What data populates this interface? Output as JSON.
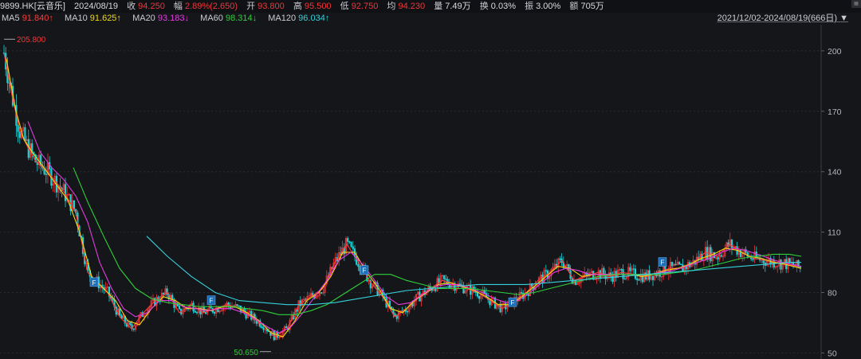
{
  "header": {
    "symbol": "9899.HK[云音乐]",
    "date": "2024/08/19",
    "close_label": "收",
    "close": "94.250",
    "change_label": "幅",
    "change": "2.89%(2.650)",
    "open_label": "开",
    "open": "93.800",
    "high_label": "高",
    "high": "95.500",
    "low_label": "低",
    "low": "92.750",
    "avg_label": "均",
    "avg": "94.230",
    "vol_label": "量",
    "vol": "7.49万",
    "turnover_label": "换",
    "turnover": "0.03%",
    "amp_label": "振",
    "amp": "3.00%",
    "amount_label": "额",
    "amount": "705万"
  },
  "range_label": "2021/12/02-2024/08/19(666日)",
  "range_arrow": "▼",
  "ma": [
    {
      "label": "MA5",
      "value": "91.840↑",
      "color": "#ff3b3b"
    },
    {
      "label": "MA10",
      "value": "91.625↑",
      "color": "#f5d90a"
    },
    {
      "label": "MA20",
      "value": "93.183↓",
      "color": "#e23be0"
    },
    {
      "label": "MA60",
      "value": "98.314↓",
      "color": "#2fcf3a"
    },
    {
      "label": "MA120",
      "value": "96.034↑",
      "color": "#36d1dc"
    }
  ],
  "chart_data": {
    "type": "line",
    "y_ticks": [
      200,
      170,
      140,
      110,
      80,
      50
    ],
    "ylim": [
      47,
      213
    ],
    "xlim": [
      0,
      666
    ],
    "annotations": {
      "max": {
        "label": "205.800",
        "x": 5,
        "y": 205.8
      },
      "min": {
        "label": "50.650",
        "x": 340,
        "y": 50.65
      }
    },
    "markers": [
      {
        "label": "F",
        "x": 118,
        "y": 85
      },
      {
        "label": "F",
        "x": 265,
        "y": 76
      },
      {
        "label": "F",
        "x": 457,
        "y": 91
      },
      {
        "label": "F",
        "x": 643,
        "y": 75
      },
      {
        "label": "F",
        "x": 831,
        "y": 95
      }
    ],
    "series": [
      {
        "name": "MA5",
        "color": "#ff3b3b",
        "x": [
          5,
          15,
          25,
          35,
          45,
          60,
          80,
          95,
          110,
          125,
          135,
          150,
          165,
          180,
          195,
          210,
          225,
          240,
          255,
          270,
          285,
          300,
          315,
          330,
          345,
          360,
          375,
          390,
          405,
          420,
          435,
          450,
          465,
          480,
          495,
          510,
          525,
          540,
          555,
          570,
          585,
          600,
          615,
          630,
          645,
          660,
          675,
          690,
          705,
          720,
          735,
          750,
          765,
          780,
          795,
          810,
          825,
          840,
          855,
          870,
          885,
          900,
          915,
          930,
          945,
          960,
          975,
          990,
          1005
        ],
        "y": [
          199,
          178,
          160,
          152,
          145,
          140,
          130,
          120,
          90,
          84,
          80,
          68,
          62,
          70,
          76,
          80,
          70,
          74,
          70,
          72,
          74,
          72,
          68,
          64,
          58,
          62,
          74,
          78,
          82,
          95,
          104,
          95,
          85,
          78,
          68,
          72,
          78,
          82,
          86,
          84,
          82,
          80,
          76,
          72,
          76,
          80,
          86,
          90,
          96,
          86,
          88,
          90,
          88,
          90,
          89,
          88,
          90,
          92,
          92,
          95,
          100,
          98,
          104,
          100,
          97,
          96,
          95,
          94,
          92
        ]
      },
      {
        "name": "MA10",
        "color": "#f5d90a",
        "x": [
          8,
          20,
          30,
          40,
          55,
          70,
          85,
          100,
          115,
          130,
          145,
          160,
          175,
          190,
          205,
          220,
          235,
          250,
          265,
          280,
          295,
          310,
          325,
          340,
          355,
          370,
          385,
          400,
          415,
          430,
          445,
          460,
          475,
          490,
          505,
          520,
          535,
          550,
          565,
          580,
          595,
          610,
          625,
          640,
          655,
          670,
          685,
          700,
          715,
          730,
          745,
          760,
          775,
          790,
          805,
          820,
          835,
          850,
          865,
          880,
          895,
          910,
          925,
          940,
          955,
          970,
          985,
          1005
        ],
        "y": [
          196,
          170,
          156,
          150,
          142,
          134,
          126,
          110,
          88,
          82,
          76,
          66,
          64,
          72,
          78,
          76,
          72,
          72,
          71,
          73,
          73,
          70,
          66,
          60,
          58,
          66,
          76,
          80,
          88,
          100,
          100,
          90,
          82,
          72,
          70,
          76,
          80,
          84,
          85,
          83,
          81,
          78,
          74,
          74,
          78,
          83,
          88,
          93,
          92,
          88,
          89,
          89,
          89,
          89,
          88,
          89,
          91,
          92,
          94,
          97,
          99,
          102,
          101,
          98,
          97,
          95,
          94,
          92
        ]
      },
      {
        "name": "MA20",
        "color": "#e23be0",
        "x": [
          35,
          50,
          65,
          80,
          95,
          110,
          125,
          140,
          155,
          170,
          185,
          200,
          215,
          230,
          245,
          260,
          275,
          290,
          305,
          320,
          335,
          350,
          365,
          380,
          395,
          410,
          425,
          440,
          455,
          470,
          485,
          500,
          515,
          530,
          545,
          560,
          575,
          590,
          605,
          620,
          635,
          650,
          665,
          680,
          695,
          710,
          725,
          740,
          755,
          770,
          785,
          800,
          815,
          830,
          845,
          860,
          875,
          890,
          905,
          920,
          935,
          950,
          965,
          980,
          1005
        ],
        "y": [
          165,
          150,
          142,
          136,
          128,
          115,
          95,
          82,
          72,
          68,
          70,
          76,
          76,
          73,
          72,
          71,
          72,
          72,
          70,
          67,
          63,
          60,
          63,
          70,
          78,
          86,
          96,
          100,
          94,
          86,
          78,
          74,
          75,
          79,
          83,
          84,
          84,
          82,
          80,
          77,
          75,
          76,
          80,
          85,
          90,
          92,
          91,
          89,
          89,
          89,
          89,
          89,
          89,
          90,
          91,
          93,
          95,
          97,
          100,
          102,
          101,
          99,
          97,
          95,
          93
        ]
      },
      {
        "name": "MA60",
        "color": "#2fcf3a",
        "x": [
          92,
          110,
          130,
          150,
          170,
          190,
          210,
          230,
          250,
          270,
          290,
          310,
          330,
          350,
          370,
          390,
          410,
          430,
          450,
          470,
          490,
          510,
          530,
          550,
          570,
          590,
          610,
          630,
          650,
          670,
          690,
          710,
          730,
          750,
          770,
          790,
          810,
          830,
          850,
          870,
          890,
          910,
          930,
          950,
          970,
          990,
          1005
        ],
        "y": [
          142,
          125,
          108,
          92,
          82,
          77,
          75,
          74,
          73,
          73,
          73,
          72,
          71,
          69,
          69,
          71,
          74,
          79,
          84,
          89,
          89,
          86,
          84,
          82,
          82,
          82,
          81,
          80,
          79,
          80,
          82,
          84,
          86,
          88,
          89,
          89,
          89,
          89,
          90,
          91,
          93,
          95,
          97,
          98,
          99,
          99,
          98
        ]
      },
      {
        "name": "MA120",
        "color": "#36d1dc",
        "x": [
          184,
          210,
          240,
          270,
          300,
          330,
          360,
          390,
          420,
          450,
          480,
          510,
          540,
          570,
          600,
          630,
          660,
          690,
          720,
          750,
          780,
          810,
          840,
          870,
          900,
          930,
          960,
          990,
          1005
        ],
        "y": [
          108,
          98,
          88,
          80,
          76,
          75,
          74,
          74,
          75,
          77,
          79,
          81,
          82,
          83,
          84,
          84,
          84,
          85,
          86,
          87,
          88,
          89,
          90,
          91,
          92,
          93,
          94,
          95,
          95
        ]
      }
    ]
  }
}
